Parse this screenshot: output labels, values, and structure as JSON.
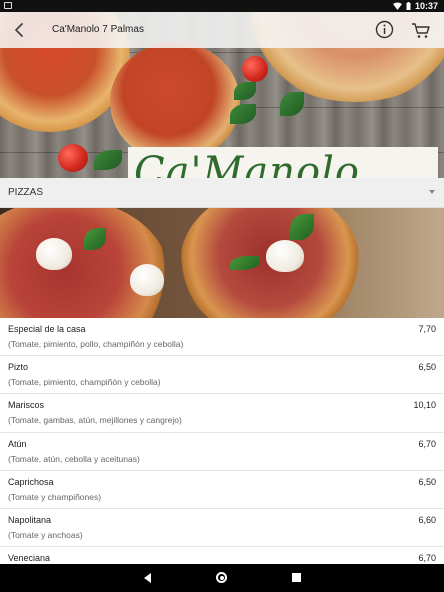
{
  "status_bar": {
    "time": "10:37"
  },
  "app_bar": {
    "title": "Ca'Manolo 7 Palmas"
  },
  "hero": {
    "logo_text": "Ca'Manolo"
  },
  "section": {
    "title": "PIZZAS"
  },
  "menu_items": [
    {
      "name": "Especial de la casa",
      "description": "(Tomate, pimiento, pollo, champiñón y cebolla)",
      "price": "7,70"
    },
    {
      "name": "Pizto",
      "description": "(Tomate, pimiento, champiñón y cebolla)",
      "price": "6,50"
    },
    {
      "name": "Mariscos",
      "description": "(Tomate, gambas, atún, mejillones y cangrejo)",
      "price": "10,10"
    },
    {
      "name": "Atún",
      "description": "(Tomate, atún, cebolla y aceitunas)",
      "price": "6,70"
    },
    {
      "name": "Caprichosa",
      "description": "(Tomate y champiñones)",
      "price": "6,50"
    },
    {
      "name": "Napolitana",
      "description": "(Tomate y anchoas)",
      "price": "6,60"
    },
    {
      "name": "Veneciana",
      "description": "",
      "price": "6,70"
    }
  ],
  "icons": {
    "back": "arrow-left-icon",
    "info": "info-icon",
    "cart": "cart-icon",
    "wifi": "wifi-icon",
    "battery": "battery-icon",
    "nav_back": "nav-back-icon",
    "nav_home": "nav-home-icon",
    "nav_recent": "nav-recent-icon"
  },
  "colors": {
    "accent_green": "#2f6b2f",
    "section_bg": "#efefef",
    "status_bar": "#111111",
    "nav_bar": "#000000"
  }
}
